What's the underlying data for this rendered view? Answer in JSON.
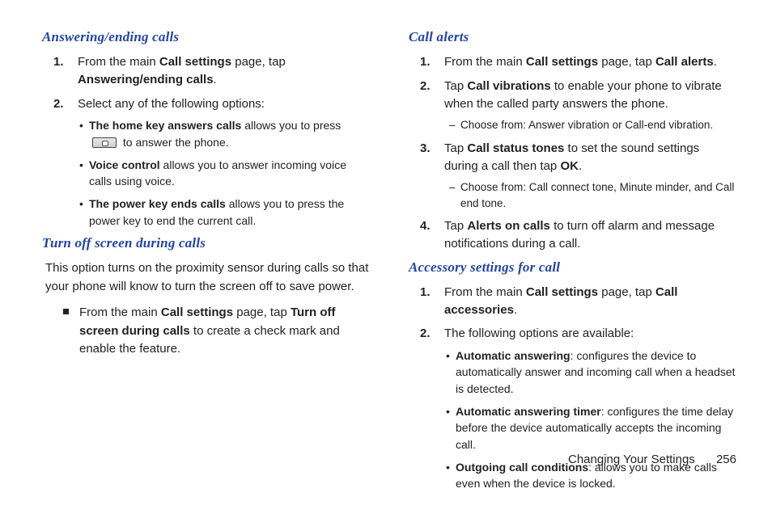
{
  "left": {
    "section1": {
      "title": "Answering/ending calls",
      "step1_marker": "1.",
      "step1_a": "From the main ",
      "step1_b": "Call settings",
      "step1_c": " page, tap ",
      "step1_d": "Answering/ending calls",
      "step1_e": ".",
      "step2_marker": "2.",
      "step2": "Select any of the following options:",
      "b1_a": "The home key answers calls",
      "b1_b": " allows you to press ",
      "b1_c": " to answer the phone.",
      "b2_a": "Voice control",
      "b2_b": " allows you to answer incoming voice calls using voice.",
      "b3_a": "The power key ends calls",
      "b3_b": " allows you to press the power key to end the current call."
    },
    "section2": {
      "title": "Turn off screen during calls",
      "para": "This option turns on the proximity sensor during calls so that your phone will know to turn the screen off to save power.",
      "sq_a": "From the main ",
      "sq_b": "Call settings",
      "sq_c": " page, tap ",
      "sq_d": "Turn off screen during calls",
      "sq_e": " to create a check mark and enable the feature."
    }
  },
  "right": {
    "section3": {
      "title": "Call alerts",
      "s1_marker": "1.",
      "s1_a": "From the main ",
      "s1_b": "Call settings",
      "s1_c": " page, tap ",
      "s1_d": "Call alerts",
      "s1_e": ".",
      "s2_marker": "2.",
      "s2_a": "Tap ",
      "s2_b": "Call vibrations",
      "s2_c": " to enable your phone to vibrate when the called party answers the phone.",
      "s2_dash": "Choose from: Answer vibration or Call-end vibration.",
      "s3_marker": "3.",
      "s3_a": "Tap ",
      "s3_b": "Call status tones",
      "s3_c": " to set the sound settings during a call then tap ",
      "s3_d": "OK",
      "s3_e": ".",
      "s3_dash": "Choose from: Call connect tone, Minute minder, and Call end tone.",
      "s4_marker": "4.",
      "s4_a": "Tap ",
      "s4_b": "Alerts on calls",
      "s4_c": " to turn off alarm and message notifications during a call."
    },
    "section4": {
      "title": "Accessory settings for call",
      "s1_marker": "1.",
      "s1_a": "From the main ",
      "s1_b": "Call settings",
      "s1_c": " page, tap ",
      "s1_d": "Call accessories",
      "s1_e": ".",
      "s2_marker": "2.",
      "s2": "The following options are available:",
      "b1_a": "Automatic answering",
      "b1_b": ": configures the device to automatically answer and incoming call when a headset is detected.",
      "b2_a": "Automatic answering timer",
      "b2_b": ": configures the time delay before the device automatically accepts the incoming call.",
      "b3_a": "Outgoing call conditions",
      "b3_b": ": allows you to make calls even when the device is locked."
    }
  },
  "footer": {
    "label": "Changing Your Settings",
    "page": "256"
  }
}
